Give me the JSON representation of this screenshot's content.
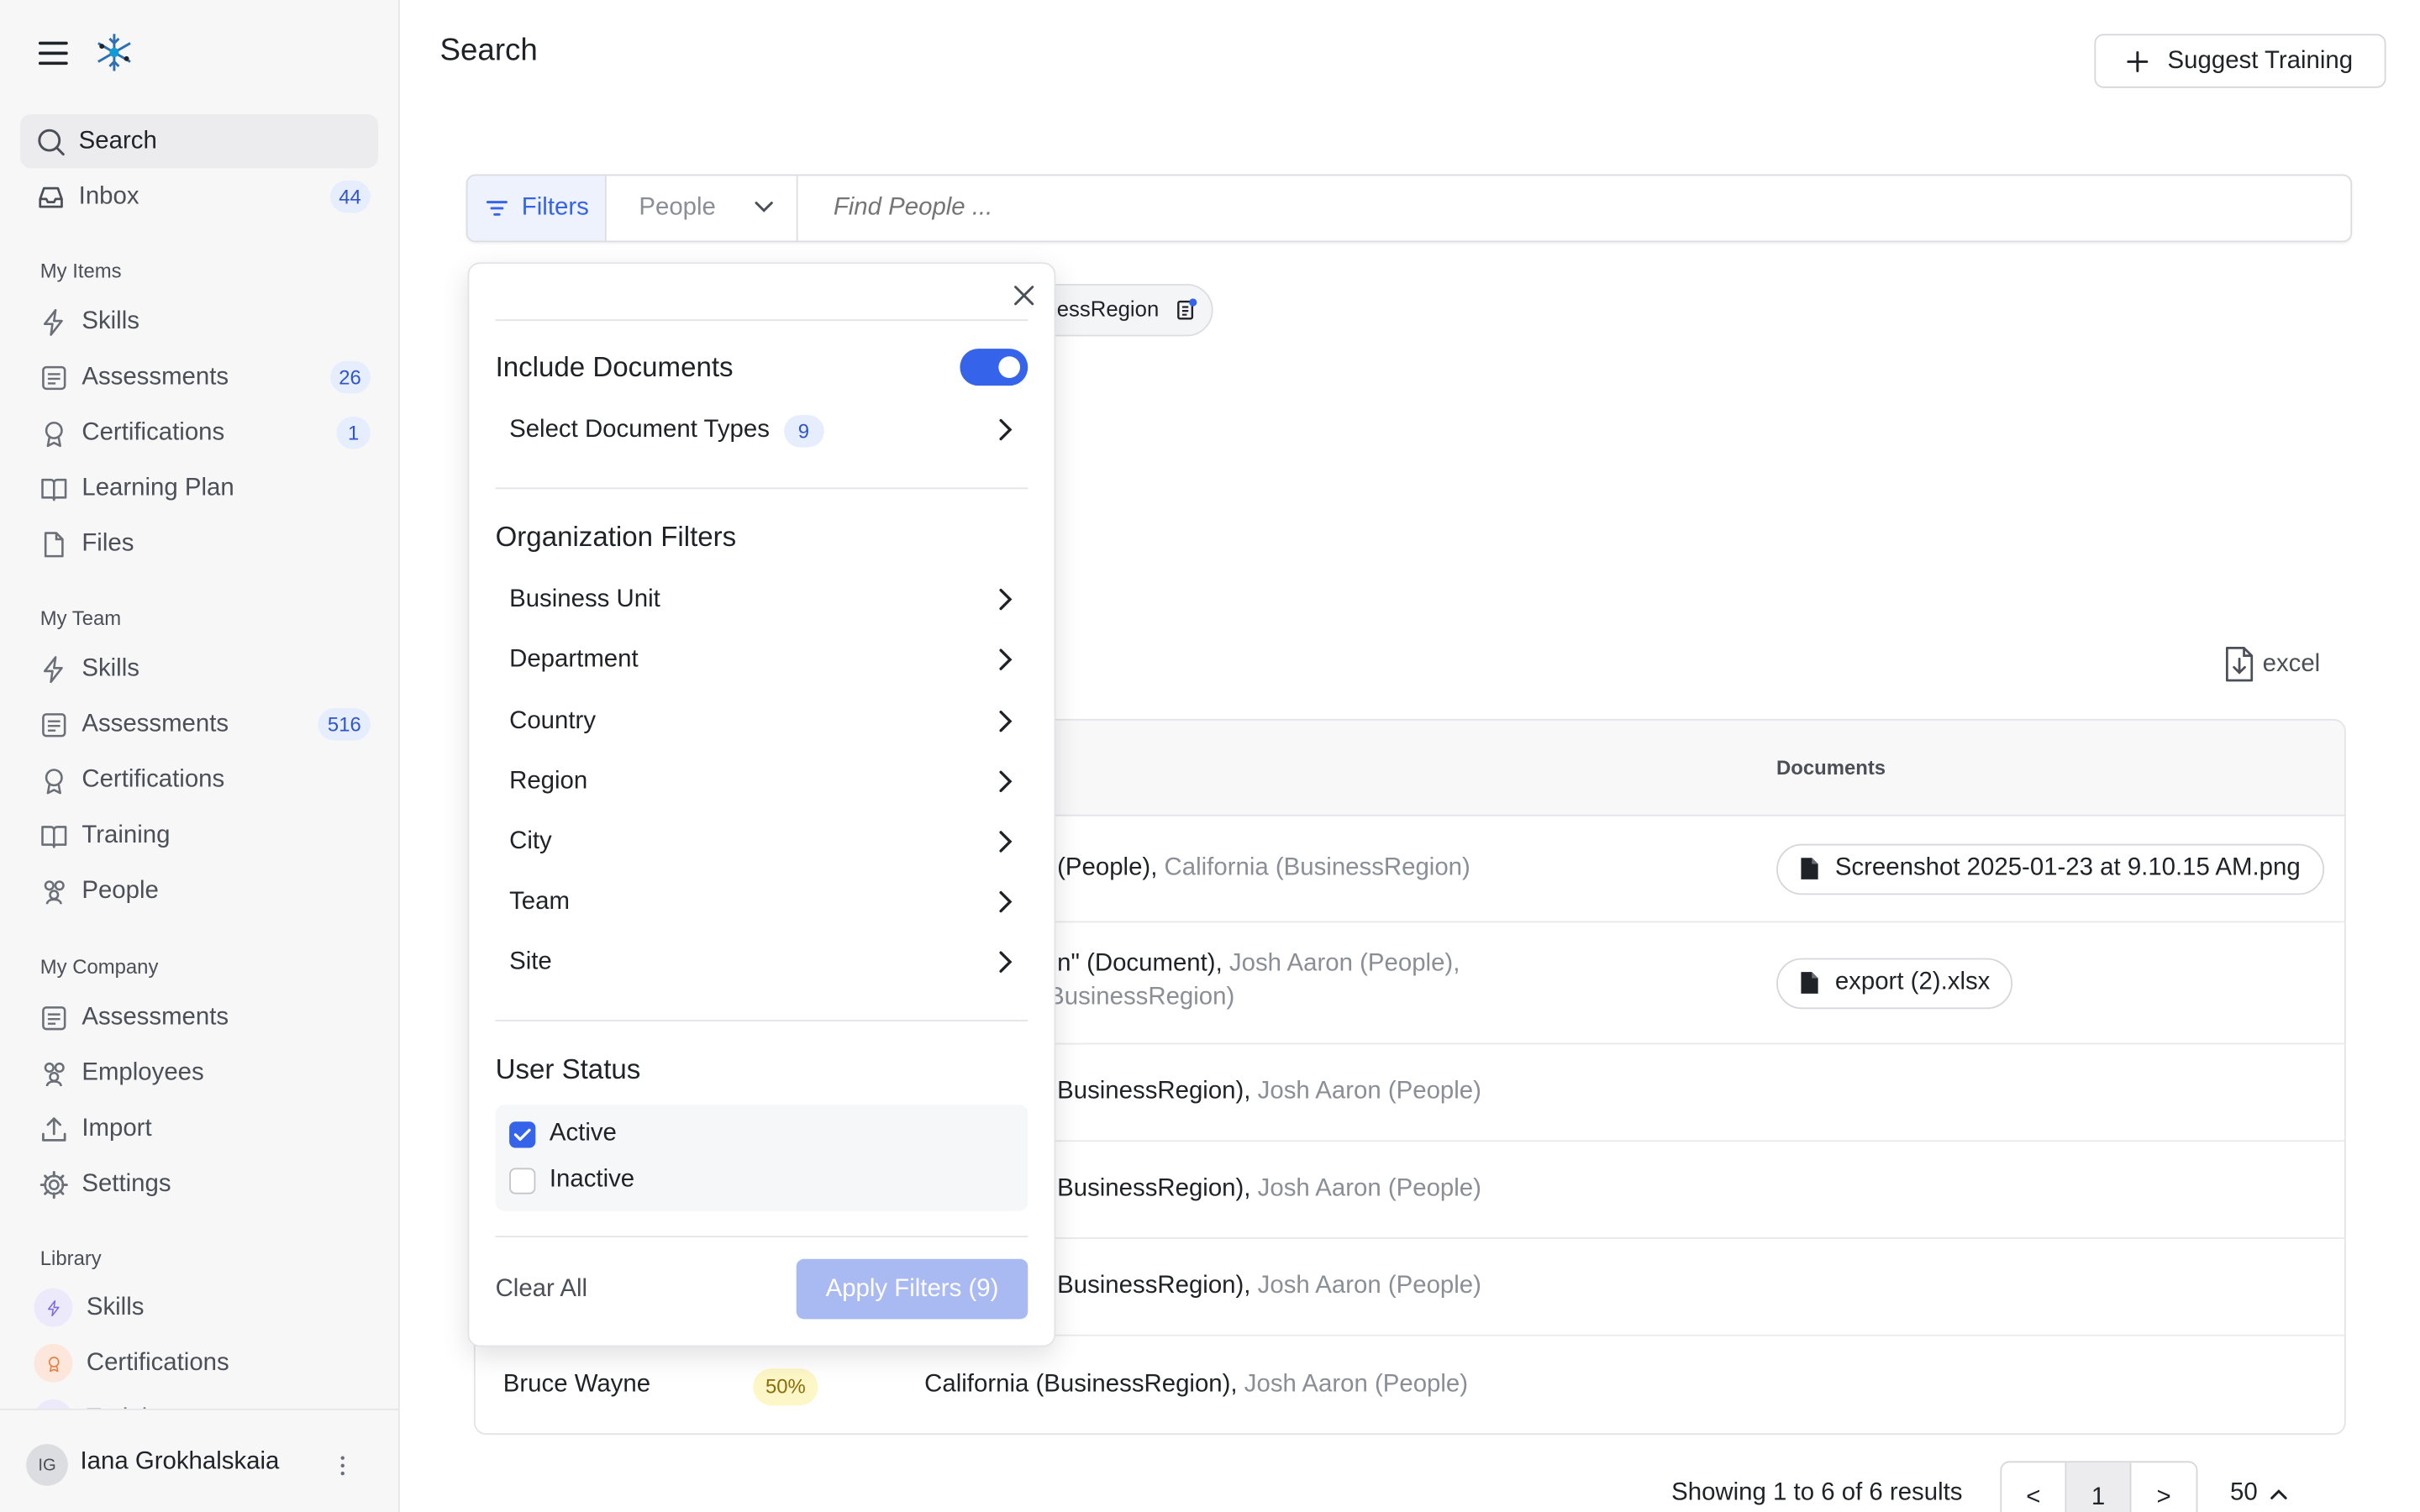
{
  "sidebar": {
    "search_label": "Search",
    "inbox": {
      "label": "Inbox",
      "count": "44"
    },
    "my_items": {
      "title": "My Items",
      "items": [
        {
          "label": "Skills",
          "icon": "bolt-icon",
          "count": ""
        },
        {
          "label": "Assessments",
          "icon": "form-icon",
          "count": "26"
        },
        {
          "label": "Certifications",
          "icon": "award-icon",
          "count": "1"
        },
        {
          "label": "Learning Plan",
          "icon": "book-icon",
          "count": ""
        },
        {
          "label": "Files",
          "icon": "file-icon",
          "count": ""
        }
      ]
    },
    "my_team": {
      "title": "My Team",
      "items": [
        {
          "label": "Skills",
          "icon": "bolt-icon",
          "count": ""
        },
        {
          "label": "Assessments",
          "icon": "form-icon",
          "count": "516"
        },
        {
          "label": "Certifications",
          "icon": "award-icon",
          "count": ""
        },
        {
          "label": "Training",
          "icon": "book-icon",
          "count": ""
        },
        {
          "label": "People",
          "icon": "people-icon",
          "count": ""
        }
      ]
    },
    "my_company": {
      "title": "My Company",
      "items": [
        {
          "label": "Assessments",
          "icon": "form-icon"
        },
        {
          "label": "Employees",
          "icon": "people-icon"
        },
        {
          "label": "Import",
          "icon": "upload-icon"
        },
        {
          "label": "Settings",
          "icon": "gear-icon"
        }
      ]
    },
    "library": {
      "title": "Library",
      "items": [
        {
          "label": "Skills",
          "icon": "bolt-icon"
        },
        {
          "label": "Certifications",
          "icon": "award-icon"
        },
        {
          "label": "Training",
          "icon": "book-icon"
        }
      ]
    },
    "user": {
      "initials": "IG",
      "name": "Iana Grokhalskaia"
    }
  },
  "header": {
    "title": "Search",
    "suggest_label": "Suggest Training"
  },
  "search": {
    "filters_label": "Filters",
    "scope_value": "People",
    "placeholder": "Find People ...",
    "active_filter_chip": "nessRegion"
  },
  "export_label": "excel",
  "table": {
    "documents_header": "Documents",
    "rows": [
      {
        "match_dark": "(People),",
        "match_grey": "California (BusinessRegion)",
        "match_line2": "",
        "document": "Screenshot 2025-01-23 at 9.10.15 AM.png"
      },
      {
        "match_dark": "n\" (Document),",
        "match_grey": "Josh Aaron (People),",
        "match_line2": "BusinessRegion)",
        "document": "export (2).xlsx"
      },
      {
        "match_dark": "BusinessRegion),",
        "match_grey": "Josh Aaron (People)",
        "match_line2": "",
        "document": ""
      },
      {
        "match_dark": "BusinessRegion),",
        "match_grey": "Josh Aaron (People)",
        "match_line2": "",
        "document": ""
      },
      {
        "match_dark": "BusinessRegion),",
        "match_grey": "Josh Aaron (People)",
        "match_line2": "",
        "document": ""
      },
      {
        "name": "Bruce Wayne",
        "score": "50%",
        "match_dark": "California (BusinessRegion),",
        "match_grey": "Josh Aaron (People)",
        "match_line2": "",
        "document": ""
      }
    ]
  },
  "pagination": {
    "summary": "Showing 1 to 6 of 6 results",
    "prev": "<",
    "current": "1",
    "next": ">",
    "page_size": "50"
  },
  "filter_panel": {
    "include_documents_label": "Include Documents",
    "include_documents_on": true,
    "doc_types_label": "Select Document Types",
    "doc_types_count": "9",
    "org_title": "Organization Filters",
    "org_filters": [
      "Business Unit",
      "Department",
      "Country",
      "Region",
      "City",
      "Team",
      "Site"
    ],
    "status_title": "User Status",
    "statuses": [
      {
        "label": "Active",
        "checked": true
      },
      {
        "label": "Inactive",
        "checked": false
      }
    ],
    "clear_label": "Clear All",
    "apply_label": "Apply Filters (9)"
  },
  "colors": {
    "accent": "#3563e9",
    "apply_disabled": "#a9b9f2",
    "badge_bg": "#e6edfd",
    "score_bg": "#fdf6c6"
  }
}
